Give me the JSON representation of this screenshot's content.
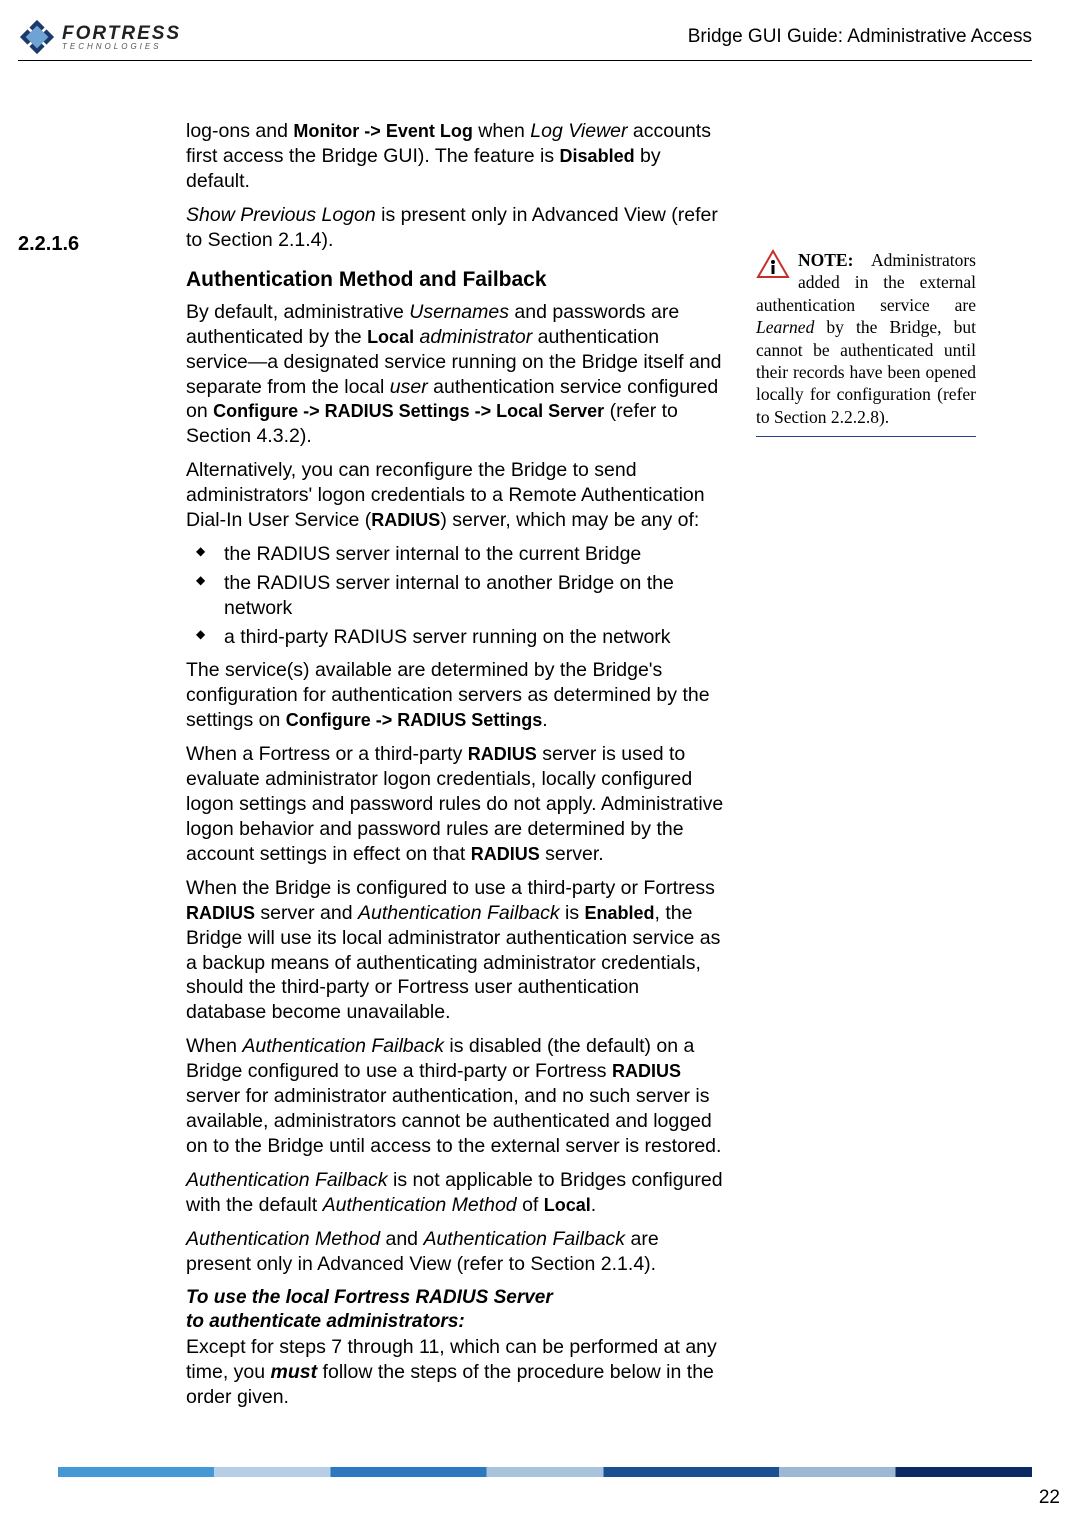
{
  "header": {
    "logo_main": "FORTRESS",
    "logo_sub": "TECHNOLOGIES",
    "guide_title": "Bridge GUI Guide: Administrative Access"
  },
  "section": {
    "number": "2.2.1.6",
    "heading": "Authentication Method and Failback"
  },
  "intro": {
    "p1a": "log-ons and ",
    "p1b": "Monitor -> Event Log",
    "p1c": " when ",
    "p1d": "Log Viewer",
    "p1e": " accounts first access the Bridge GUI). The feature is ",
    "p1f": "Disabled",
    "p1g": " by default.",
    "p2a": "Show Previous Logon",
    "p2b": " is present only in Advanced View (refer to Section 2.1.4)."
  },
  "body": {
    "p1a": "By default, administrative ",
    "p1b": "Usernames",
    "p1c": " and passwords are authenticated by the ",
    "p1d": "Local",
    "p1e": " administrator",
    "p1f": " authentication service—a designated service running on the Bridge itself and separate from the local ",
    "p1g": "user",
    "p1h": " authentication service configured on ",
    "p1i": "Configure -> RADIUS Settings -> Local Server",
    "p1j": " (refer to Section 4.3.2).",
    "p2a": "Alternatively, you can reconfigure the Bridge to send administrators' logon credentials to a Remote Authentication Dial-In User Service (",
    "p2b": "RADIUS",
    "p2c": ") server, which may be any of:",
    "bullets": [
      "the RADIUS server internal to the current Bridge",
      "the RADIUS server internal to another Bridge on the network",
      "a third-party RADIUS server running on the network"
    ],
    "p3a": "The service(s) available are determined by the Bridge's configuration for authentication servers as determined by the settings on ",
    "p3b": "Configure -> RADIUS Settings",
    "p3c": ".",
    "p4a": "When a Fortress or a third-party ",
    "p4b": "RADIUS",
    "p4c": " server is used to evaluate administrator logon credentials, locally configured logon settings and password rules do not apply. Administrative logon behavior and password rules are determined by the account settings in effect on that ",
    "p4d": "RADIUS",
    "p4e": " server.",
    "p5a": "When the Bridge is configured to use a third-party or Fortress ",
    "p5b": "RADIUS",
    "p5c": " server and ",
    "p5d": "Authentication Failback",
    "p5e": " is ",
    "p5f": "Enabled",
    "p5g": ", the Bridge will use its local administrator authentication service as a backup means of authenticating administrator credentials, should the third-party or Fortress user authentication database become unavailable.",
    "p6a": "When ",
    "p6b": "Authentication Failback",
    "p6c": " is disabled (the default) on a Bridge configured to use a third-party or Fortress ",
    "p6d": "RADIUS",
    "p6e": " server for administrator authentication, and no such server is available, administrators cannot be authenticated and logged on to the Bridge until access to the external server is restored.",
    "p7a": "Authentication Failback",
    "p7b": " is not applicable to Bridges configured with the default ",
    "p7c": "Authentication Method",
    "p7d": " of ",
    "p7e": "Local",
    "p7f": ".",
    "p8a": "Authentication Method",
    "p8b": " and ",
    "p8c": "Authentication Failback",
    "p8d": " are present only in Advanced View (refer to Section 2.1.4).",
    "proc1": "To use the local Fortress RADIUS Server",
    "proc2": "to authenticate administrators:",
    "p9a": "Except for steps 7 through 11, which can be performed at any time, you ",
    "p9b": "must",
    "p9c": " follow the steps of the procedure below in the order given."
  },
  "note": {
    "label": "NOTE:",
    "text1": " Administrators added in the external authentication service are ",
    "text2": "Learned",
    "text3": " by the Bridge, but cannot be authenticated until their records have been opened locally for configuration (refer to Section 2.2.2.8)."
  },
  "page_number": "22"
}
